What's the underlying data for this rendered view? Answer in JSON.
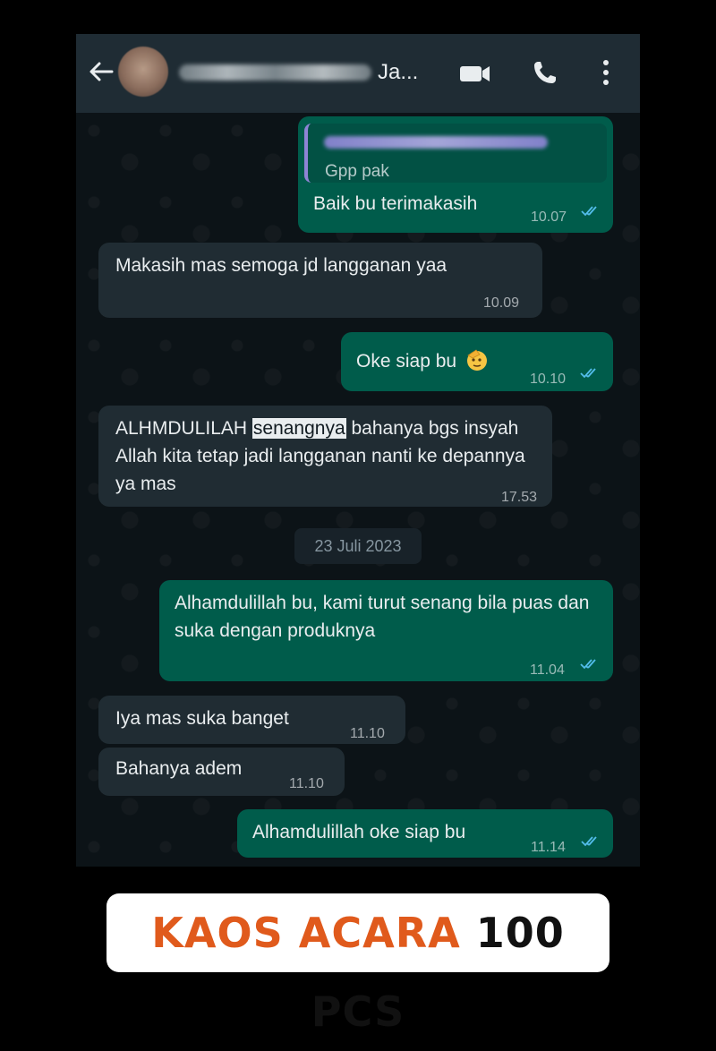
{
  "header": {
    "back_icon": "arrow-left-icon",
    "contact_name": "Ja...",
    "icons": [
      "video-call-icon",
      "voice-call-icon",
      "more-vert-icon"
    ]
  },
  "messages": [
    {
      "direction": "out",
      "quote": "Gpp pak",
      "text": "Baik bu terimakasih",
      "time": "10.07",
      "status": "read"
    },
    {
      "direction": "in",
      "text": "Makasih mas semoga jd langganan yaa",
      "time": "10.09"
    },
    {
      "direction": "out",
      "text": "Oke siap bu",
      "emoji": "saluting-face-emoji",
      "time": "10.10",
      "status": "read"
    },
    {
      "direction": "in",
      "text_before": "ALHMDULILAH ",
      "text_highlight": "senangnya",
      "text_after": " bahanya bgs insyah Allah kita tetap jadi langganan nanti ke depannya ya mas",
      "time": "17.53"
    },
    {
      "direction": "out",
      "text": "Alhamdulillah bu, kami turut senang bila puas dan suka dengan produknya",
      "time": "11.04",
      "status": "read"
    },
    {
      "direction": "in",
      "text": "Iya mas suka banget",
      "time": "11.10"
    },
    {
      "direction": "in",
      "text": "Bahanya adem",
      "time": "11.10"
    },
    {
      "direction": "out",
      "text": "Alhamdulillah oke siap bu",
      "time": "11.14",
      "status": "read"
    }
  ],
  "date_separator": "23 Juli 2023",
  "banner": {
    "part1": "KAOS ACARA",
    "part2": "100 PCS"
  },
  "colors": {
    "header_bg": "#1f2c34",
    "chat_bg": "#0c1317",
    "outgoing_bubble": "#005c4b",
    "incoming_bubble": "#202c33",
    "read_ticks": "#53bdeb",
    "banner_orange": "#e05a1c"
  }
}
